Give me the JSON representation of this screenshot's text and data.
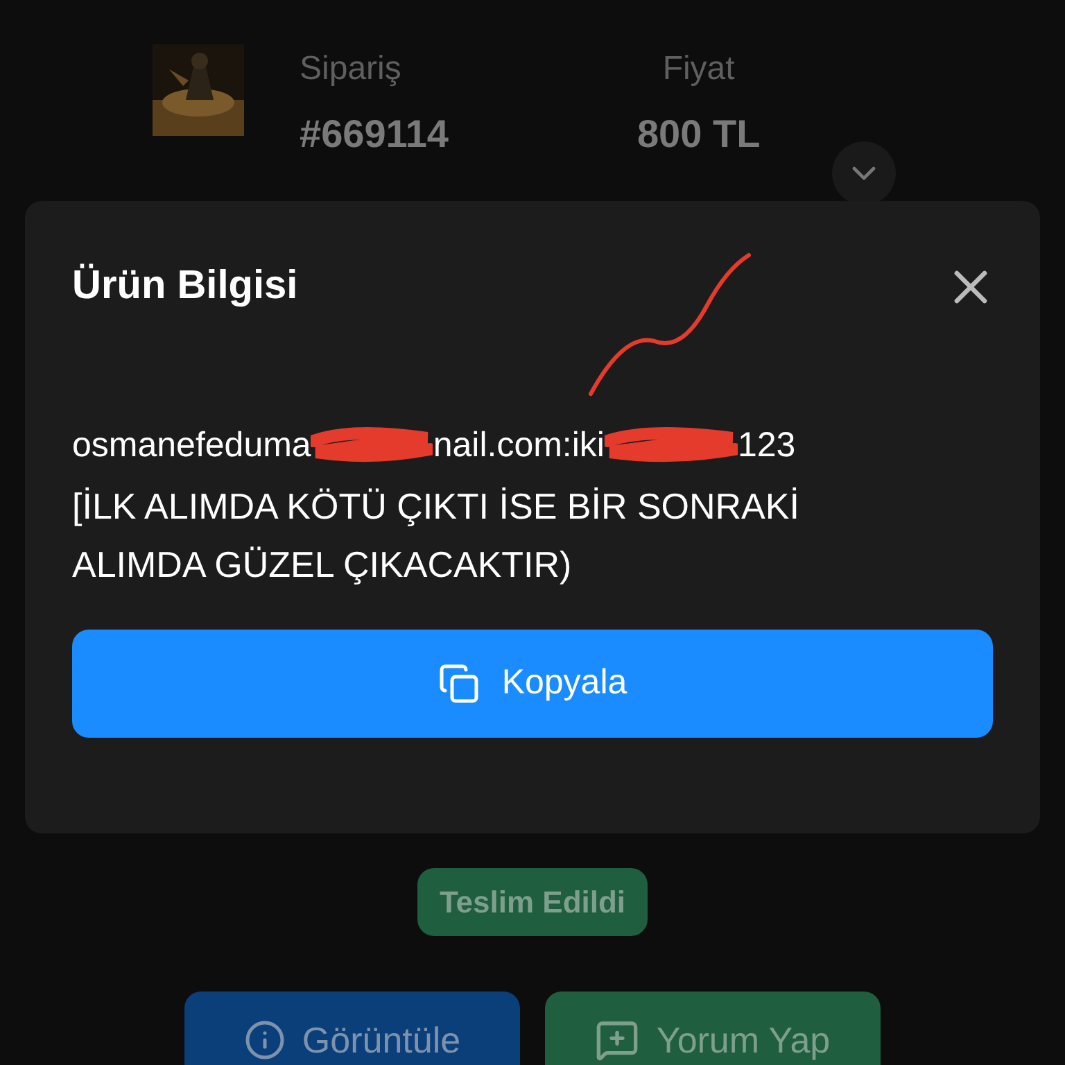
{
  "order": {
    "label": "Sipariş",
    "number": "#669114"
  },
  "price": {
    "label": "Fiyat",
    "value": "800 TL"
  },
  "status": {
    "badge": "Teslim Edildi"
  },
  "actions": [
    {
      "label": "Görüntüle",
      "kind": "view"
    },
    {
      "label": "Yorum Yap",
      "kind": "comment"
    }
  ],
  "dialog": {
    "title": "Ürün Bilgisi",
    "content_parts": [
      "osmanefeduma",
      "nail.com:iki",
      "123"
    ],
    "note": "[İLK ALIMDA KÖTÜ ÇIKTI İSE BİR SONRAKİ ALIMDA GÜZEL ÇIKACAKTIR)",
    "copy_button": "Kopyala"
  }
}
